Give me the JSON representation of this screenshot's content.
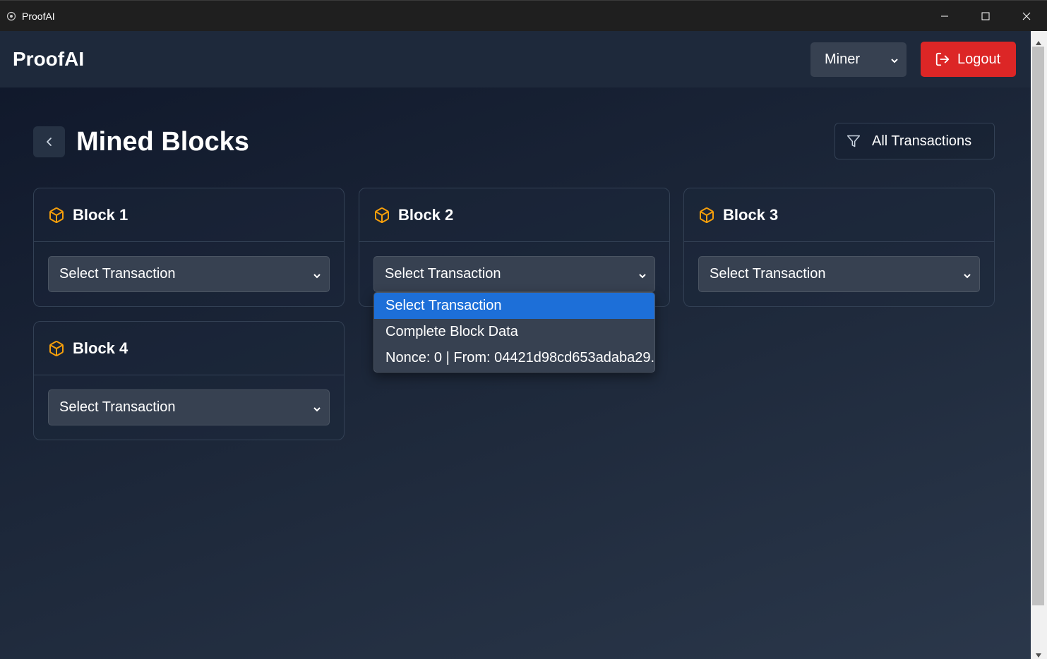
{
  "window": {
    "title": "ProofAI"
  },
  "navbar": {
    "brand": "ProofAI",
    "role_selected": "Miner",
    "logout_label": "Logout"
  },
  "page": {
    "title": "Mined Blocks",
    "filter_label": "All Transactions"
  },
  "blocks": [
    {
      "title": "Block 1",
      "select_value": "Select Transaction"
    },
    {
      "title": "Block 2",
      "select_value": "Select Transaction"
    },
    {
      "title": "Block 3",
      "select_value": "Select Transaction"
    },
    {
      "title": "Block 4",
      "select_value": "Select Transaction"
    }
  ],
  "dropdown": {
    "options": [
      "Select Transaction",
      "Complete Block Data",
      "Nonce: 0 | From: 04421d98cd653adaba29..."
    ]
  },
  "colors": {
    "accent_orange": "#f59e0b",
    "logout_red": "#dc2626",
    "selected_blue": "#1d6fd8"
  }
}
